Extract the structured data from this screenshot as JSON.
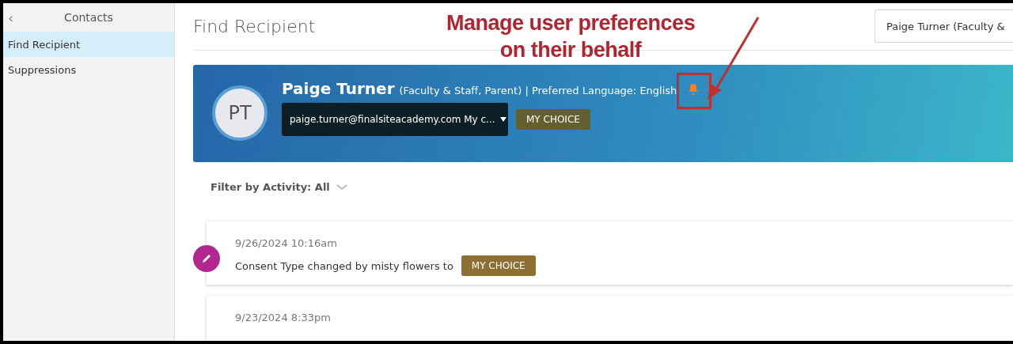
{
  "sidebar": {
    "back": "‹",
    "title": "Contacts",
    "items": [
      {
        "label": "Find Recipient",
        "selected": true
      },
      {
        "label": "Suppressions",
        "selected": false
      }
    ]
  },
  "page": {
    "title": "Find Recipient",
    "search": {
      "value": "Paige Turner (Faculty &"
    }
  },
  "profile": {
    "initials": "PT",
    "name": "Paige Turner",
    "details": "(Faculty & Staff, Parent) | Preferred Language: English",
    "email_select": "paige.turner@finalsiteacademy.com My c...",
    "consent_badge": "MY CHOICE"
  },
  "filter": {
    "label": "Filter by Activity: All"
  },
  "activity": [
    {
      "date": "9/26/2024 10:16am",
      "text": "Consent Type changed by misty flowers to",
      "badge": "MY CHOICE"
    },
    {
      "date": "9/23/2024 8:33pm"
    }
  ],
  "callout": {
    "lines": [
      "Manage user preferences",
      "on their behalf"
    ]
  }
}
